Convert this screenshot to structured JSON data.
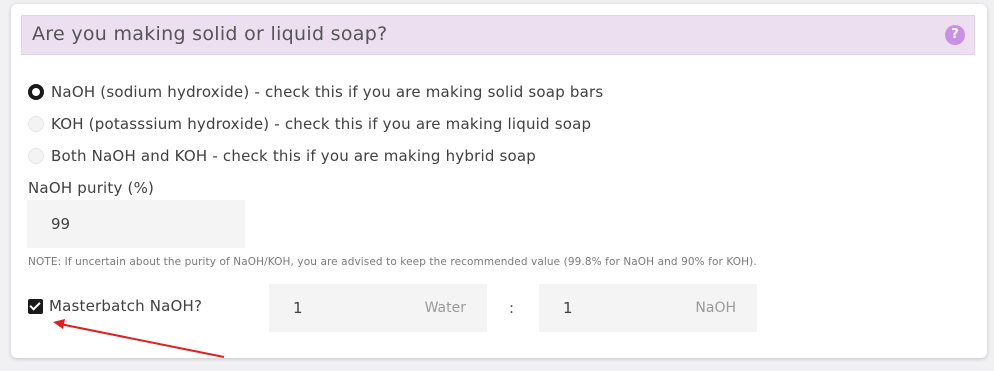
{
  "section": {
    "title": "Are you making solid or liquid soap?",
    "help_icon": "?"
  },
  "lye_options": [
    {
      "label": "NaOH (sodium hydroxide) - check this if you are making solid soap bars",
      "checked": true
    },
    {
      "label": "KOH (potasssium hydroxide) - check this if you are making liquid soap",
      "checked": false
    },
    {
      "label": "Both NaOH and KOH - check this if you are making hybrid soap",
      "checked": false
    }
  ],
  "purity": {
    "label": "NaOH purity (%)",
    "value": "99"
  },
  "note": "NOTE: If uncertain about the purity of NaOH/KOH, you are advised to keep the recommended value (99.8% for NaOH and 90% for KOH).",
  "masterbatch": {
    "label": "Masterbatch NaOH?",
    "checked": true,
    "water_value": "1",
    "water_unit": "Water",
    "separator": ":",
    "naoh_value": "1",
    "naoh_unit": "NaOH"
  },
  "colors": {
    "header_bg": "#ecdff0",
    "help_icon": "#c990e6",
    "arrow": "#e02020",
    "input_bg": "#f4f4f5"
  }
}
